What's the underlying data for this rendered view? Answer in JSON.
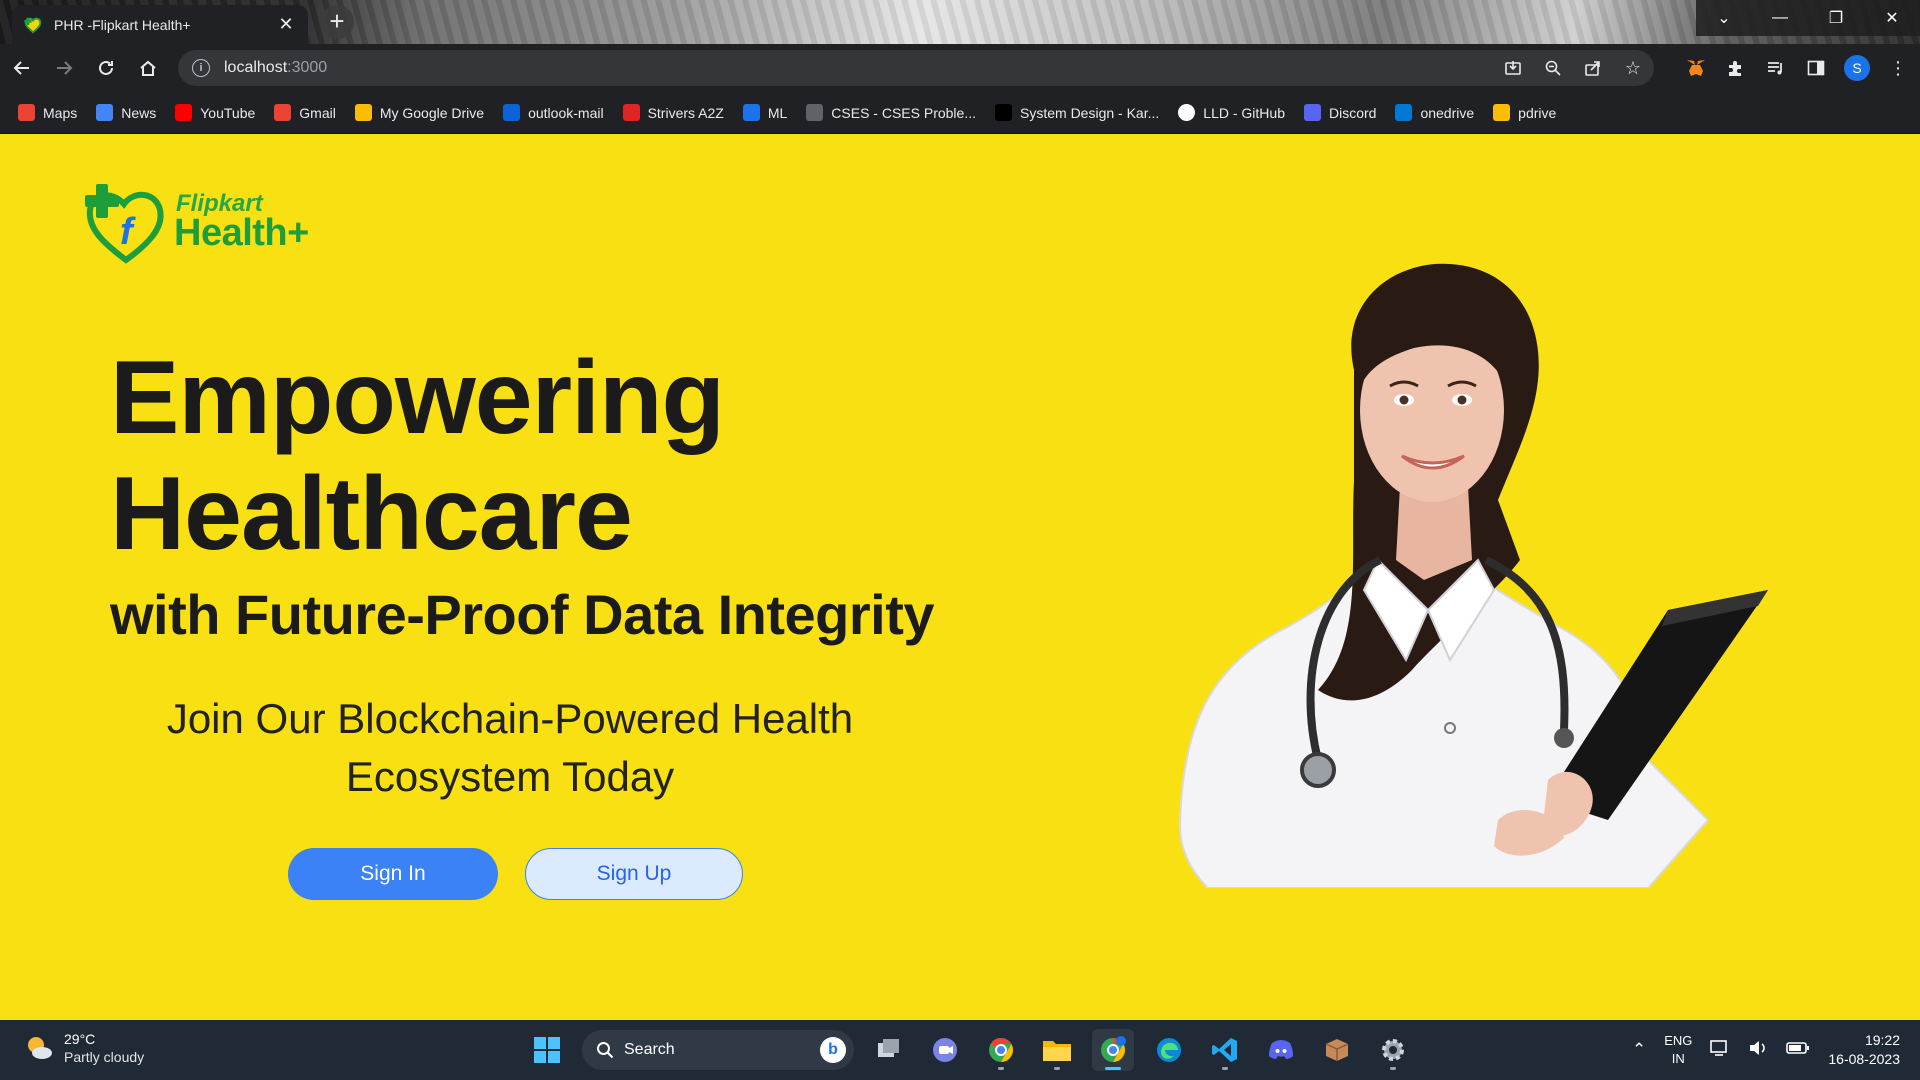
{
  "browser": {
    "tab_title": "PHR -Flipkart Health+",
    "tab_close": "✕",
    "new_tab": "+",
    "url_host": "localhost",
    "url_port": ":3000",
    "window_controls": [
      "⌄",
      "—",
      "❐",
      "✕"
    ],
    "profile_initial": "S"
  },
  "bookmarks": [
    {
      "label": "Maps",
      "icon": "maps-icon",
      "color": "#ea4335"
    },
    {
      "label": "News",
      "icon": "news-icon",
      "color": "#4285f4"
    },
    {
      "label": "YouTube",
      "icon": "youtube-icon",
      "color": "#ff0000"
    },
    {
      "label": "Gmail",
      "icon": "gmail-icon",
      "color": "#ea4335"
    },
    {
      "label": "My Google Drive",
      "icon": "drive-icon",
      "color": "#fbbc04"
    },
    {
      "label": "outlook-mail",
      "icon": "outlook-icon",
      "color": "#0a64d6"
    },
    {
      "label": "Strivers A2Z",
      "icon": "tuf-icon",
      "color": "#e02424"
    },
    {
      "label": "ML",
      "icon": "c-icon",
      "color": "#1a73e8"
    },
    {
      "label": "CSES - CSES Proble...",
      "icon": "globe-icon",
      "color": "#5f6368"
    },
    {
      "label": "System Design - Kar...",
      "icon": "dev-icon",
      "color": "#000000"
    },
    {
      "label": "LLD - GitHub",
      "icon": "github-icon",
      "color": "#ffffff"
    },
    {
      "label": "Discord",
      "icon": "discord-icon",
      "color": "#5865f2"
    },
    {
      "label": "onedrive",
      "icon": "onedrive-icon",
      "color": "#0078d4"
    },
    {
      "label": "pdrive",
      "icon": "drive-icon",
      "color": "#fbbc04"
    }
  ],
  "page": {
    "logo_top": "Flipkart",
    "logo_bottom": "Health+",
    "headline_line1": "Empowering",
    "headline_line2": "Healthcare",
    "subheadline": "with Future-Proof Data Integrity",
    "cta_line1": "Join Our Blockchain-Powered Health",
    "cta_line2": "Ecosystem Today",
    "signin_label": "Sign In",
    "signup_label": "Sign Up",
    "background_color": "#f8e012"
  },
  "taskbar": {
    "temperature": "29°C",
    "condition": "Partly cloudy",
    "search_label": "Search",
    "language_line1": "ENG",
    "language_line2": "IN",
    "time": "19:22",
    "date": "16-08-2023"
  }
}
